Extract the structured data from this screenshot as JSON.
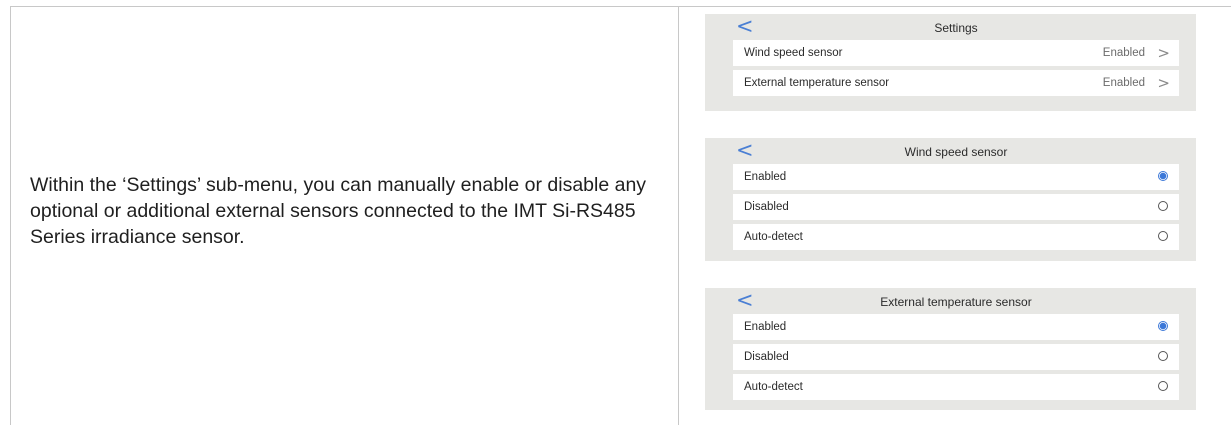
{
  "description": "Within the ‘Settings’ sub-menu, you can manually enable or disable any optional or additional external sensors connected to the IMT Si-RS485 Series irradiance sensor.",
  "settings_panel": {
    "back_glyph": "<",
    "title": "Settings",
    "items": [
      {
        "label": "Wind speed sensor",
        "value": "Enabled",
        "chevron": ">"
      },
      {
        "label": "External temperature sensor",
        "value": "Enabled",
        "chevron": ">"
      }
    ]
  },
  "wind_panel": {
    "back_glyph": "<",
    "title": "Wind speed sensor",
    "options": [
      {
        "label": "Enabled",
        "selected": true
      },
      {
        "label": "Disabled",
        "selected": false
      },
      {
        "label": "Auto-detect",
        "selected": false
      }
    ]
  },
  "temp_panel": {
    "back_glyph": "<",
    "title": "External temperature sensor",
    "options": [
      {
        "label": "Enabled",
        "selected": true
      },
      {
        "label": "Disabled",
        "selected": false
      },
      {
        "label": "Auto-detect",
        "selected": false
      }
    ]
  },
  "colors": {
    "accent": "#3c78d8",
    "panel_bg": "#e7e7e4",
    "row_bg": "#ffffff"
  }
}
